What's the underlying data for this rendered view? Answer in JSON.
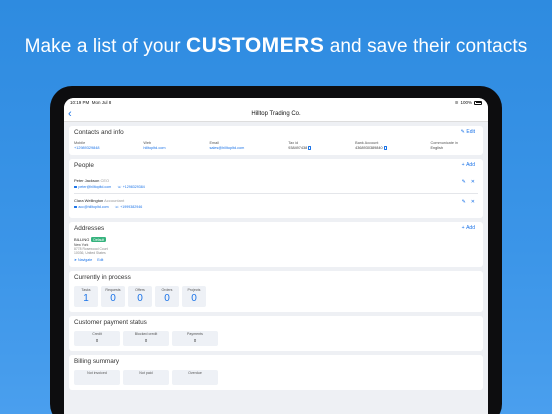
{
  "headline": {
    "pre": "Make a list of your ",
    "strong": "CUSTOMERS",
    "post": " and save their contacts"
  },
  "status_bar": {
    "time": "10:19 PM",
    "date": "Mon Jul 8",
    "battery": "100%"
  },
  "nav": {
    "title": "Hilltop Trading Co."
  },
  "contacts_info": {
    "title": "Contacts and info",
    "action": "Edit",
    "fields": [
      {
        "label": "Mobile",
        "value": "+12989329848"
      },
      {
        "label": "Web",
        "value": "hilltopltd.com"
      },
      {
        "label": "Email",
        "value": "sales@hilltopltd.com"
      },
      {
        "label": "Tax id",
        "value": "938497438"
      },
      {
        "label": "Bank Account",
        "value": "4368930389840"
      },
      {
        "label": "Communicate in",
        "value": "English"
      }
    ]
  },
  "people": {
    "title": "People",
    "action": "Add",
    "items": [
      {
        "name": "Peter Jackson",
        "role": "CEO",
        "email": "peter@hilltopltd.com",
        "phone": "+1298329384"
      },
      {
        "name": "Clara Wellington",
        "role": "Accountant",
        "email": "acc@hilltopltd.com",
        "phone": "+1999382946"
      }
    ]
  },
  "addresses": {
    "title": "Addresses",
    "action": "Add",
    "item": {
      "name": "BILLING",
      "badge": "Default",
      "city": "New York",
      "street": "8778 Rosewood Court",
      "zip": "10036, United States",
      "navigate": "Navigate",
      "edit": "Edit"
    }
  },
  "in_process": {
    "title": "Currently in process",
    "stats": [
      {
        "label": "Tasks",
        "value": "1"
      },
      {
        "label": "Requests",
        "value": "0"
      },
      {
        "label": "Offers",
        "value": "0"
      },
      {
        "label": "Orders",
        "value": "0"
      },
      {
        "label": "Projects",
        "value": "0"
      }
    ]
  },
  "payment_status": {
    "title": "Customer payment status",
    "stats": [
      {
        "label": "Credit",
        "value": "0"
      },
      {
        "label": "Blocked credit",
        "value": "0"
      },
      {
        "label": "Payments",
        "value": "0"
      }
    ]
  },
  "billing": {
    "title": "Billing summary",
    "stats": [
      {
        "label": "Not invoiced"
      },
      {
        "label": "Not paid"
      },
      {
        "label": "Overdue"
      }
    ]
  },
  "colors": {
    "accent": "#1a73e8",
    "background": "#2e8be0",
    "badge": "#36b37e"
  }
}
